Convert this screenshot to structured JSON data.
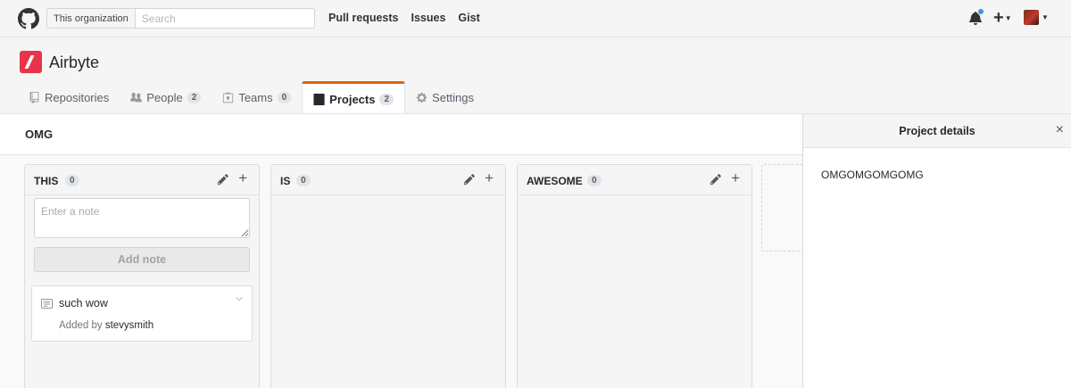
{
  "header": {
    "search_scope": "This organization",
    "search_placeholder": "Search",
    "nav": [
      "Pull requests",
      "Issues",
      "Gist"
    ],
    "new_label": "+",
    "accent": "#4a90d9"
  },
  "org": {
    "name": "Airbyte",
    "logo_color": "#e8334a",
    "tabs": [
      {
        "label": "Repositories",
        "count": "",
        "icon": "repo-icon"
      },
      {
        "label": "People",
        "count": "2",
        "icon": "people-icon"
      },
      {
        "label": "Teams",
        "count": "0",
        "icon": "teams-icon"
      },
      {
        "label": "Projects",
        "count": "2",
        "icon": "project-icon",
        "selected": true
      },
      {
        "label": "Settings",
        "count": "",
        "icon": "gear-icon"
      }
    ]
  },
  "project": {
    "title": "OMG",
    "columns": [
      {
        "title": "THIS",
        "count": "0"
      },
      {
        "title": "IS",
        "count": "0"
      },
      {
        "title": "AWESOME",
        "count": "0"
      }
    ],
    "note_placeholder": "Enter a note",
    "add_note_label": "Add note",
    "card": {
      "title": "such wow",
      "added_by_prefix": "Added by",
      "author": "stevysmith"
    }
  },
  "panel": {
    "title": "Project details",
    "description": "OMGOMGOMGOMG",
    "close": "×"
  }
}
